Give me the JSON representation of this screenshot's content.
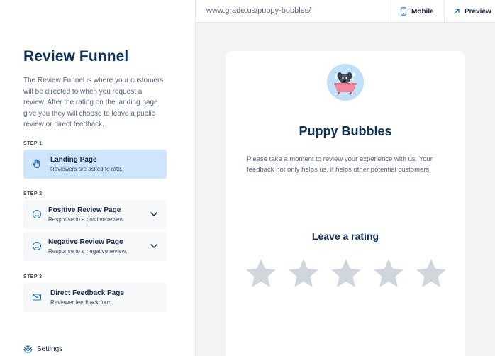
{
  "sidebar": {
    "title": "Review Funnel",
    "description": "The Review Funnel is where your customers will be directed to when you request a review. After the rating on the landing page give you they will choose to leave a public review or direct feedback.",
    "steps": [
      {
        "label": "STEP 1"
      },
      {
        "label": "STEP 2"
      },
      {
        "label": "STEP 3"
      }
    ],
    "cards": [
      {
        "title": "Landing Page",
        "subtitle": "Reviewers are asked to rate.",
        "icon": "hand-icon"
      },
      {
        "title": "Positive Review Page",
        "subtitle": "Response to a positive review.",
        "icon": "smile-icon"
      },
      {
        "title": "Negative Review Page",
        "subtitle": "Response to a negative review.",
        "icon": "frown-icon"
      },
      {
        "title": "Direct Feedback Page",
        "subtitle": "Reviewer feedback form.",
        "icon": "envelope-icon"
      }
    ],
    "settings_label": "Settings"
  },
  "topbar": {
    "url": "www.grade.us/puppy-bubbles/",
    "mobile_label": "Mobile",
    "preview_label": "Preview"
  },
  "preview": {
    "business_name": "Puppy Bubbles",
    "blurb": "Please take a moment to review your experience with us. Your feedback not only helps us, it helps other potential customers.",
    "rating_title": "Leave a rating",
    "star_count": 5
  },
  "colors": {
    "accent": "#1f6fb8",
    "active_card": "#cfe5fb",
    "star": "#cfd6dd",
    "heading": "#0e3157"
  }
}
